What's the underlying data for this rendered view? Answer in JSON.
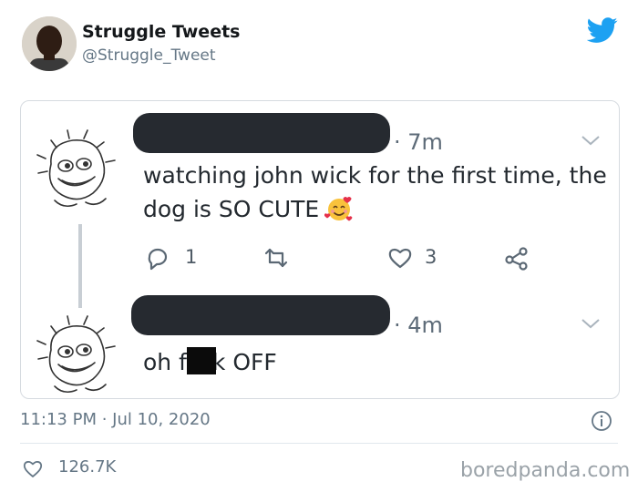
{
  "author": {
    "name": "Struggle Tweets",
    "handle": "@Struggle_Tweet"
  },
  "embedded_thread": {
    "tweet1": {
      "time": "· 7m",
      "line1": "watching john wick for the first time, the",
      "line2": "dog is SO CUTE",
      "emoji_icon": "smiling-face-with-hearts-icon",
      "reply_count": "1",
      "like_count": "3"
    },
    "tweet2": {
      "time": "· 4m",
      "text_before": "oh f",
      "text_after": "k OFF"
    }
  },
  "footer": {
    "timestamp": "11:13 PM · Jul 10, 2020",
    "likes": "126.7K"
  },
  "watermark": "boredpanda.com",
  "colors": {
    "twitter_blue": "#1DA1F2",
    "redaction": "#262a30"
  }
}
